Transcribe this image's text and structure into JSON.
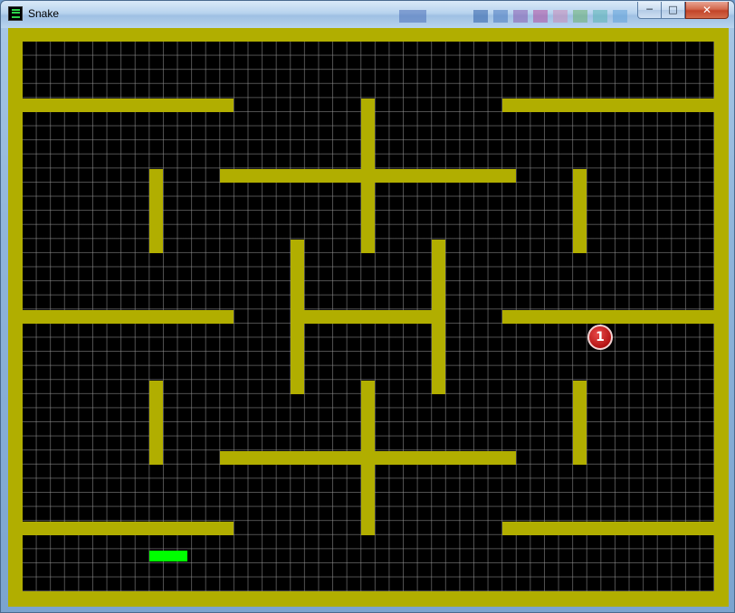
{
  "window": {
    "title": "Snake",
    "controls": {
      "minimize": "─",
      "maximize": "□",
      "close": "✕"
    }
  },
  "game": {
    "food_value": "1",
    "colors": {
      "wall": "#b1ae00",
      "floor": "#000000",
      "grid": "#969696",
      "snake": "#00ff00",
      "food": "#c41d1d"
    }
  }
}
